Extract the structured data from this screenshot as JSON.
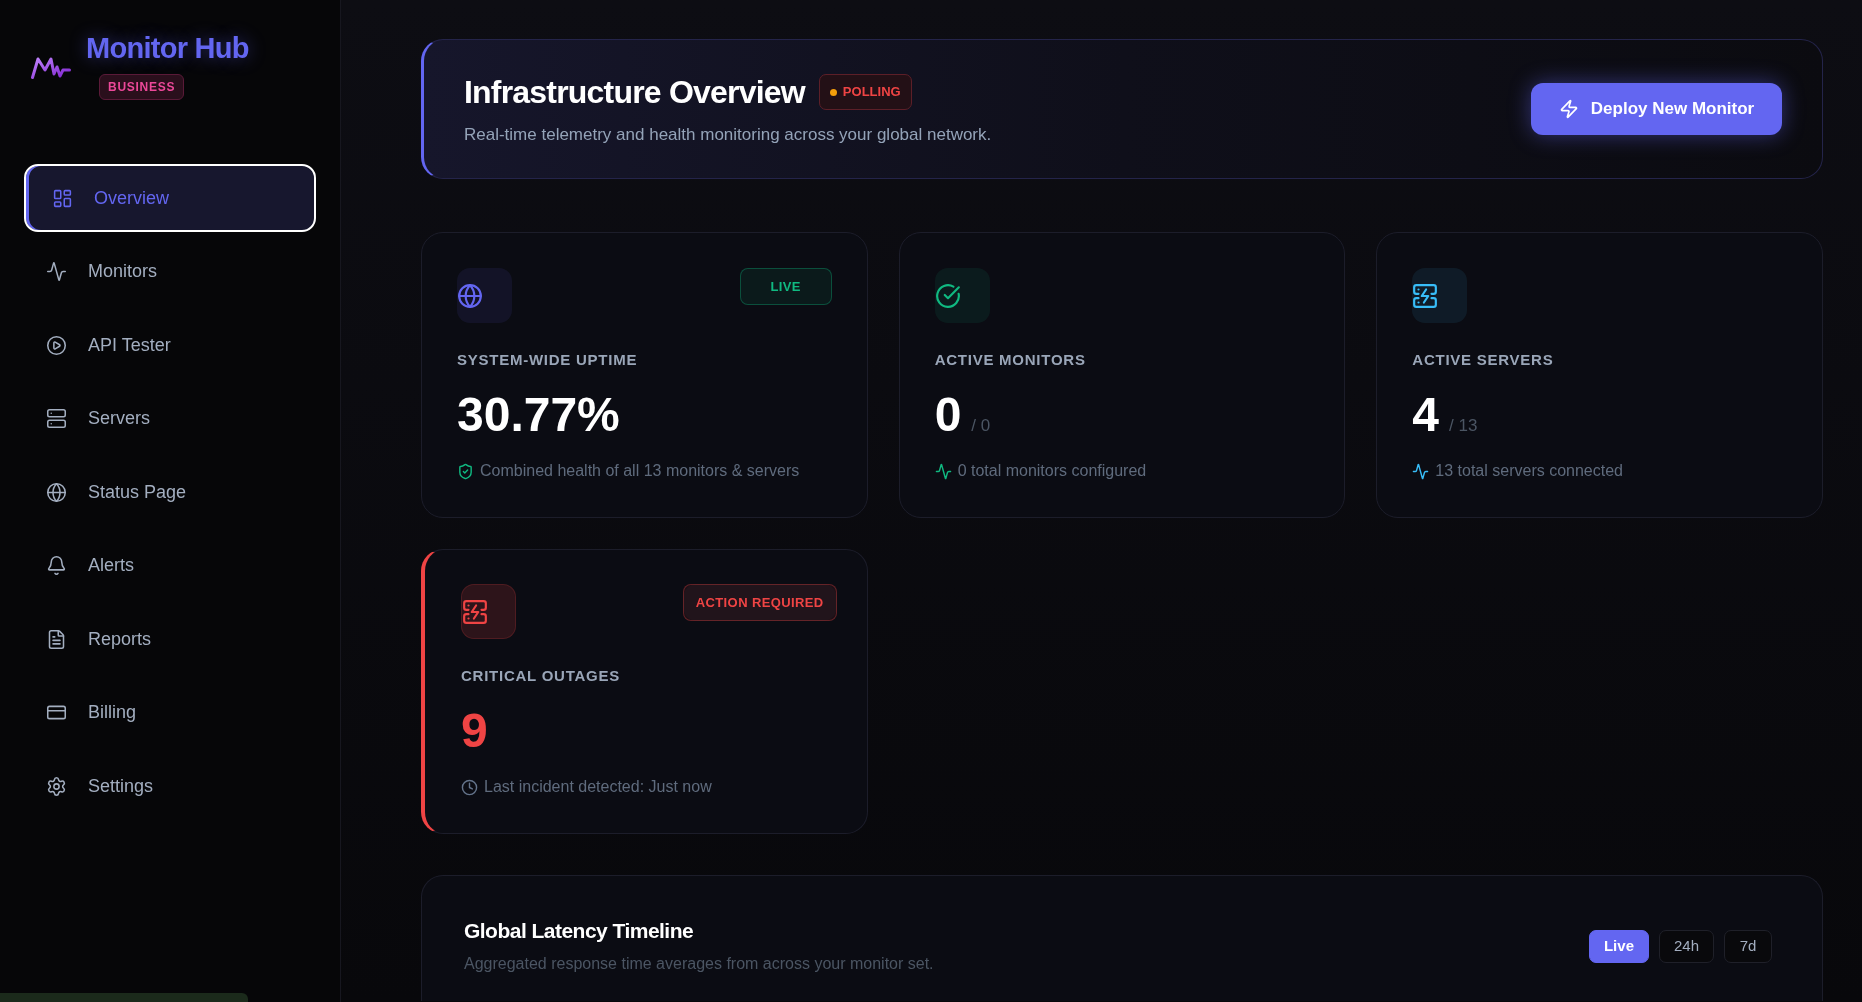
{
  "sidebar": {
    "brand": "Monitor Hub",
    "plan_badge": "BUSINESS",
    "items": [
      {
        "label": "Overview",
        "selected": true
      },
      {
        "label": "Monitors",
        "selected": false
      },
      {
        "label": "API Tester",
        "selected": false
      },
      {
        "label": "Servers",
        "selected": false
      },
      {
        "label": "Status Page",
        "selected": false
      },
      {
        "label": "Alerts",
        "selected": false
      },
      {
        "label": "Reports",
        "selected": false
      },
      {
        "label": "Billing",
        "selected": false
      },
      {
        "label": "Settings",
        "selected": false
      }
    ]
  },
  "header": {
    "title": "Infrastructure Overview",
    "status_badge": "POLLING",
    "subtitle": "Real-time telemetry and health monitoring across your global network.",
    "action_button": "Deploy New Monitor"
  },
  "stat_cards": [
    {
      "kind": "stat",
      "color": "#6366f1",
      "badge": {
        "text": "LIVE",
        "color": "#10b981"
      },
      "label": "SYSTEM-WIDE UPTIME",
      "value": "30.77%",
      "footer": {
        "text": "Combined health of all 13 monitors & servers",
        "color": "#10b981"
      }
    },
    {
      "kind": "stat",
      "color": "#10b981",
      "label": "ACTIVE MONITORS",
      "value": "0",
      "total": "/ 0",
      "footer": {
        "text": "0 total monitors configured",
        "color": "#10b981"
      }
    },
    {
      "kind": "stat",
      "color": "#38bdf8",
      "label": "ACTIVE SERVERS",
      "value": "4",
      "total": "/ 13",
      "footer": {
        "text": "13 total servers connected",
        "color": "#38bdf8"
      }
    },
    {
      "kind": "alert",
      "color": "#ef4444",
      "badge": {
        "text": "ACTION REQUIRED",
        "color": "#ef4444"
      },
      "label": "CRITICAL OUTAGES",
      "value": "9",
      "footer": {
        "text": "Last incident detected: Just now",
        "color": "#64748b"
      }
    }
  ],
  "latency": {
    "title": "Global Latency Timeline",
    "subtitle": "Aggregated response time averages from across your monitor set.",
    "ranges": [
      {
        "label": "Live",
        "selected": true
      },
      {
        "label": "24h",
        "selected": false
      },
      {
        "label": "7d",
        "selected": false
      }
    ]
  }
}
